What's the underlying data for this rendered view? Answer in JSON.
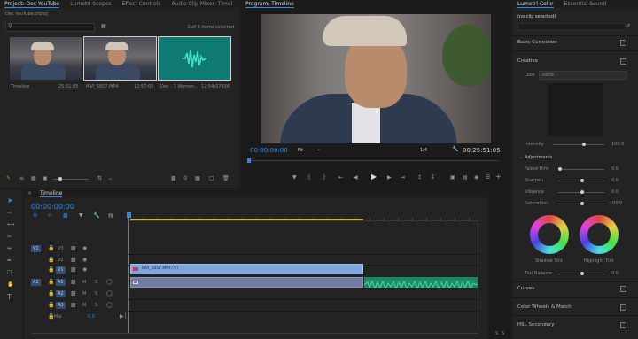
{
  "project": {
    "tabs": [
      "Project: Dec YouTube",
      "Lumetri Scopes",
      "Effect Controls",
      "Audio Clip Mixer: Timel"
    ],
    "path": "Dec YouTube.prproj",
    "selection_count": "2 of 3 items selected",
    "items": [
      {
        "name": "Timeline",
        "duration": "25:51:05",
        "type": "video"
      },
      {
        "name": "MVI_5857.MP4",
        "duration": "12:57:05",
        "type": "video"
      },
      {
        "name": "Dec - 1 Women...",
        "duration": "12:54:07936",
        "type": "audio"
      }
    ]
  },
  "program": {
    "title": "Program: Timeline",
    "timecode": "00:00:00:00",
    "fit": "Fit",
    "resolution": "1/4",
    "duration": "00:25:51:05"
  },
  "timeline": {
    "tab": "Timeline",
    "timecode": "00:00:00:00",
    "video_tracks": [
      {
        "source": "V1",
        "label": "V3"
      },
      {
        "source": "",
        "label": "V2"
      },
      {
        "source": "V1",
        "label": "V1"
      }
    ],
    "audio_tracks": [
      {
        "source": "A1",
        "label": "A1",
        "m": "M",
        "s": "S"
      },
      {
        "source": "",
        "label": "A2",
        "m": "M",
        "s": "S"
      },
      {
        "source": "",
        "label": "A3",
        "m": "M",
        "s": "S"
      }
    ],
    "mix_label": "Mix",
    "mix_value": "0.0",
    "video_clip_label": "MVI_5857.MP4 [V]",
    "meter_labels": [
      "S",
      "S"
    ]
  },
  "lumetri": {
    "tabs": [
      "Lumetri Color",
      "Essential Sound"
    ],
    "clip": "(no clip selected)",
    "sections": {
      "basic": "Basic Correction",
      "creative": "Creative",
      "curves": "Curves",
      "wheels": "Color Wheels & Match",
      "hsl": "HSL Secondary"
    },
    "look_label": "Look",
    "look_value": "None",
    "intensity_label": "Intensity",
    "intensity_value": "100.0",
    "adjustments_label": "Adjustments",
    "sliders": [
      {
        "label": "Faded Film",
        "value": "0.0"
      },
      {
        "label": "Sharpen",
        "value": "0.0"
      },
      {
        "label": "Vibrance",
        "value": "0.0"
      },
      {
        "label": "Saturation",
        "value": "100.0"
      }
    ],
    "shadow_tint": "Shadow Tint",
    "highlight_tint": "Highlight Tint",
    "tint_balance_label": "Tint Balance",
    "tint_balance_value": "0.0"
  }
}
